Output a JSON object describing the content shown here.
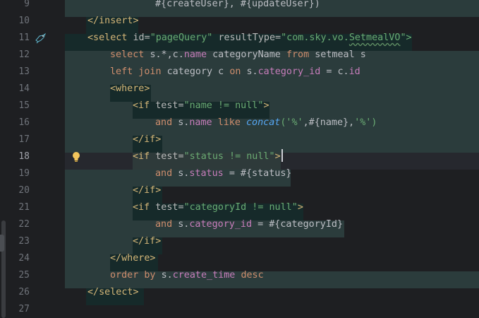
{
  "gutter": {
    "line_numbers": [
      "9",
      "10",
      "11",
      "12",
      "13",
      "14",
      "15",
      "16",
      "17",
      "18",
      "19",
      "20",
      "21",
      "22",
      "23",
      "24",
      "25",
      "26",
      "27"
    ],
    "current_line": "18",
    "icons": {
      "mapper_icon": "mybatis-bird-icon",
      "hint_icon": "lightbulb-icon"
    }
  },
  "code": {
    "l9": {
      "tokens": [
        "#{createUser}, #{updateUser})"
      ]
    },
    "l10": {
      "tokens": [
        "</insert>"
      ]
    },
    "l11": {
      "tokens": [
        "<select",
        "id=",
        "\"pageQuery\"",
        "resultType=",
        "\"com.sky.vo.",
        "SetmealVO",
        "\">"
      ]
    },
    "l12": {
      "tokens": [
        "select",
        "s.*,c.",
        "name",
        "categoryName",
        "from",
        "setmeal s"
      ]
    },
    "l13": {
      "tokens": [
        "left join",
        "category c",
        "on",
        "s.",
        "category_id",
        "= c.",
        "id"
      ]
    },
    "l14": {
      "tokens": [
        "<where>"
      ]
    },
    "l15": {
      "tokens": [
        "<if",
        "test=",
        "\"name != null\"",
        ">"
      ]
    },
    "l16": {
      "tokens": [
        "and",
        "s.",
        "name",
        "like",
        "concat",
        "('%'",
        ",#{name},",
        "'%')"
      ]
    },
    "l17": {
      "tokens": [
        "</if>"
      ]
    },
    "l18": {
      "tokens": [
        "<if",
        "test=",
        "\"status != null\"",
        ">"
      ]
    },
    "l19": {
      "tokens": [
        "and",
        "s.",
        "status",
        "= #{status}"
      ]
    },
    "l20": {
      "tokens": [
        "</if>"
      ]
    },
    "l21": {
      "tokens": [
        "<if",
        "test=",
        "\"categoryId != null\"",
        ">"
      ]
    },
    "l22": {
      "tokens": [
        "and",
        "s.",
        "category_id",
        "= #{categoryId}"
      ]
    },
    "l23": {
      "tokens": [
        "</if>"
      ]
    },
    "l24": {
      "tokens": [
        "</where>"
      ]
    },
    "l25": {
      "tokens": [
        "order by",
        "s.",
        "create_time",
        "desc"
      ]
    },
    "l26": {
      "tokens": [
        "</select>"
      ]
    }
  },
  "colors": {
    "background": "#1e1f22",
    "teal_highlight": "#2b3c3c",
    "tag_highlight": "#162a2a",
    "tag": "#d5b778",
    "string": "#6aab73",
    "keyword": "#cf8e6d",
    "field": "#c77dbb",
    "function": "#56a8f5"
  }
}
